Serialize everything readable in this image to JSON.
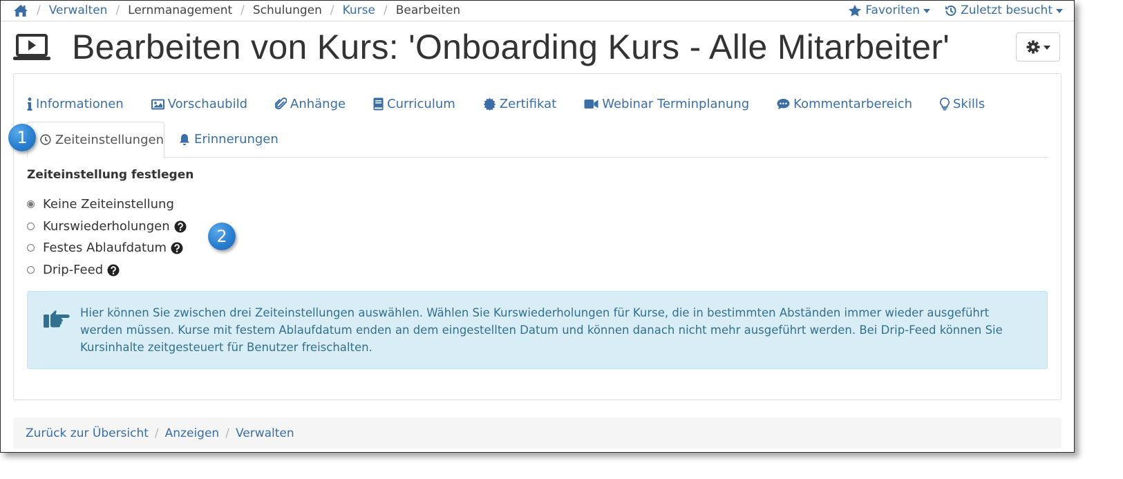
{
  "breadcrumb": {
    "items": [
      "Verwalten",
      "Lernmanagement",
      "Schulungen",
      "Kurse",
      "Bearbeiten"
    ]
  },
  "topnav": {
    "favorites": "Favoriten",
    "recent": "Zuletzt besucht"
  },
  "header": {
    "title": "Bearbeiten von Kurs: 'Onboarding Kurs - Alle Mitarbeiter'"
  },
  "tabs": {
    "row1": [
      "Informationen",
      "Vorschaubild",
      "Anhänge",
      "Curriculum",
      "Zertifikat",
      "Webinar Terminplanung",
      "Kommentarbereich",
      "Skills"
    ],
    "active": "Zeiteinstellungen",
    "reminders": "Erinnerungen"
  },
  "badges": [
    "1",
    "2"
  ],
  "form": {
    "label": "Zeiteinstellung festlegen",
    "options": [
      "Keine Zeiteinstellung",
      "Kurswiederholungen",
      "Festes Ablaufdatum",
      "Drip-Feed"
    ],
    "selected": "Keine Zeiteinstellung"
  },
  "info": {
    "text": "Hier können Sie zwischen drei Zeiteinstellungen auswählen. Wählen Sie Kurswiederholungen für Kurse, die in bestimmten Abständen immer wieder ausgeführt werden müssen. Kurse mit festem Ablaufdatum enden an dem eingestellten Datum und können danach nicht mehr ausgeführt werden. Bei Drip-Feed können Sie Kursinhalte zeitgesteuert für Benutzer freischalten."
  },
  "footer": {
    "links": [
      "Zurück zur Übersicht",
      "Anzeigen",
      "Verwalten"
    ]
  },
  "colors": {
    "link": "#3a6ea5",
    "info_bg": "#d9edf7",
    "info_text": "#31708f",
    "badge": "#2a7fcf"
  }
}
